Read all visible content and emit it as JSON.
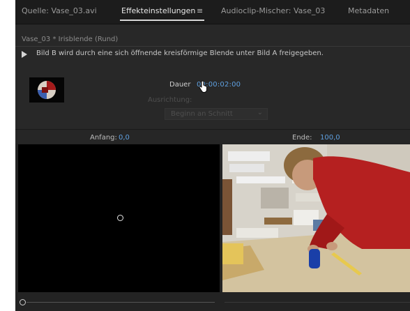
{
  "tabs": [
    {
      "label": "Quelle: Vase_03.avi",
      "active": false
    },
    {
      "label": "Effekteinstellungen",
      "active": true
    },
    {
      "label": "Audioclip-Mischer: Vase_03",
      "active": false
    },
    {
      "label": "Metadaten",
      "active": false
    }
  ],
  "panel_menu_icon": "≡",
  "clip_title": "Vase_03 * Irisblende (Rund)",
  "description": "Bild B wird durch eine sich öffnende kreisförmige Blende unter Bild A freigegeben.",
  "dauer": {
    "label": "Dauer",
    "value": "00:00:02:00"
  },
  "ausrichtung": {
    "label": "Ausrichtung:",
    "value": "Beginn an Schnitt"
  },
  "anfang": {
    "label": "Anfang:",
    "value": "0,0"
  },
  "ende": {
    "label": "Ende:",
    "value": "100,0"
  },
  "colors": {
    "accent": "#5fa0e0",
    "panel_bg": "#232323",
    "tab_bg": "#1c1c1c"
  },
  "icons": {
    "play": "play-icon",
    "cursor": "hand-cursor-icon",
    "chevron": "chevron-down-icon",
    "center": "center-point-handle-icon",
    "scroll": "scroll-handle-icon"
  }
}
